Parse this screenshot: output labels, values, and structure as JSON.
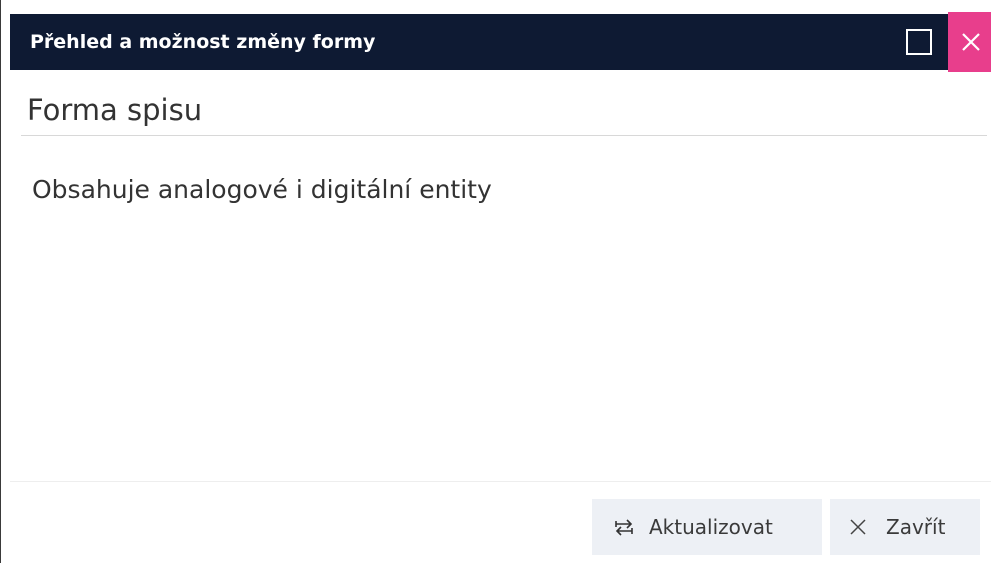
{
  "dialog": {
    "title": "Přehled a možnost změny formy",
    "maximize_icon": "maximize-icon",
    "close_icon": "close-icon",
    "close_color": "#e83e8c",
    "titlebar_color": "#0e1a33"
  },
  "content": {
    "section_title": "Forma spisu",
    "value": "Obsahuje analogové i digitální entity"
  },
  "footer": {
    "update_label": "Aktualizovat",
    "update_icon": "swap-arrows-icon",
    "close_label": "Zavřít",
    "close_icon": "close-icon"
  }
}
